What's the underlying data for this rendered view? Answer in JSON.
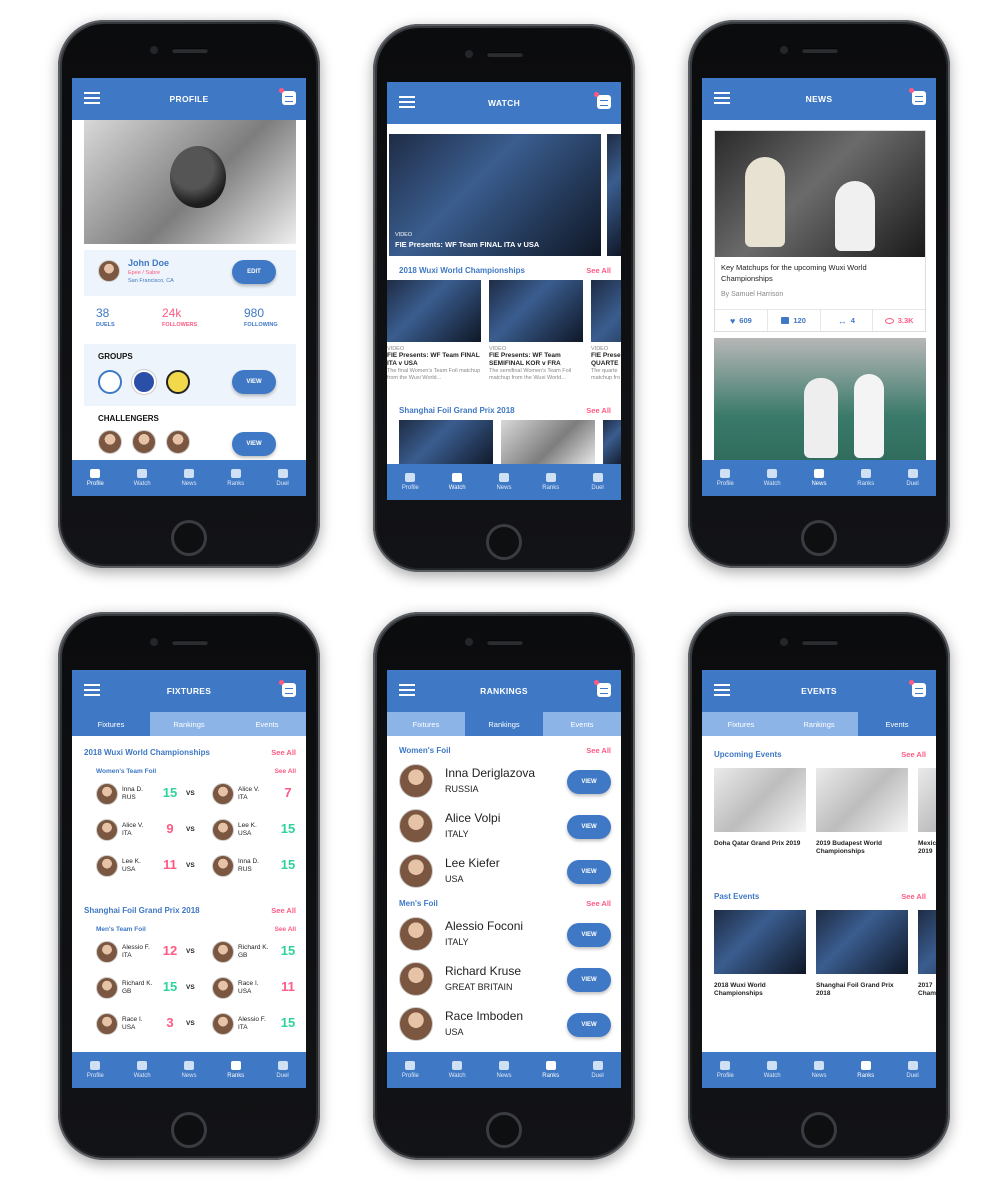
{
  "tabbar": [
    "Profile",
    "Watch",
    "News",
    "Ranks",
    "Duel"
  ],
  "subtabs": [
    "Fixtures",
    "Rankings",
    "Events"
  ],
  "profile": {
    "title": "PROFILE",
    "name": "John Doe",
    "weapons": "Epee / Sabre",
    "location": "San Francisco, CA",
    "edit_label": "EDIT",
    "stats": [
      {
        "value": "38",
        "label": "DUELS",
        "color": "#3f78c4"
      },
      {
        "value": "24k",
        "label": "FOLLOWERS",
        "color": "#ff5a82"
      },
      {
        "value": "980",
        "label": "FOLLOWING",
        "color": "#3f78c4"
      }
    ],
    "groups_label": "GROUPS",
    "challengers_label": "CHALLENGERS",
    "view_label": "VIEW"
  },
  "watch": {
    "title": "WATCH",
    "hero_tag": "VIDEO",
    "hero_title": "FIE Presents: WF Team FINAL ITA v USA",
    "section1": "2018 Wuxi World Championships",
    "section2": "Shanghai Foil Grand Prix 2018",
    "see_all": "See All",
    "videos": [
      {
        "tag": "VIDEO",
        "title": "FIE Presents: WF Team FINAL ITA v USA",
        "desc": "The final Women's Team Foil matchup from the Wuxi World..."
      },
      {
        "tag": "VIDEO",
        "title": "FIE Presents: WF Team SEMIFINAL KOR v FRA",
        "desc": "The semifinal Women's Team Foil matchup from the Wuxi World..."
      },
      {
        "tag": "VIDEO",
        "title": "FIE Prese QUARTE",
        "desc": "The quarte matchup fro"
      }
    ]
  },
  "news": {
    "title": "NEWS",
    "headline": "Key Matchups for the upcoming Wuxi World Championships",
    "byline": "By Samuel Harrison",
    "likes": "609",
    "comments": "120",
    "shares": "4",
    "views": "3.3K",
    "accent": "#ff5a82"
  },
  "fixtures": {
    "title": "FIXTURES",
    "see_all": "See All",
    "groups": [
      {
        "event": "2018 Wuxi World Championships",
        "sub": "Women's Team Foil",
        "matches": [
          {
            "a": "Inna D.",
            "ac": "RUS",
            "as": "15",
            "ascol": "#2fd39a",
            "b": "Alice V.",
            "bc": "ITA",
            "bs": "7",
            "bscol": "#ff5a82"
          },
          {
            "a": "Alice V.",
            "ac": "ITA",
            "as": "9",
            "ascol": "#ff5a82",
            "b": "Lee K.",
            "bc": "USA",
            "bs": "15",
            "bscol": "#2fd39a"
          },
          {
            "a": "Lee K.",
            "ac": "USA",
            "as": "11",
            "ascol": "#ff5a82",
            "b": "Inna D.",
            "bc": "RUS",
            "bs": "15",
            "bscol": "#2fd39a"
          }
        ]
      },
      {
        "event": "Shanghai Foil Grand Prix 2018",
        "sub": "Men's Team Foil",
        "matches": [
          {
            "a": "Alessio F.",
            "ac": "ITA",
            "as": "12",
            "ascol": "#ff5a82",
            "b": "Richard K.",
            "bc": "GB",
            "bs": "15",
            "bscol": "#2fd39a"
          },
          {
            "a": "Richard K.",
            "ac": "GB",
            "as": "15",
            "ascol": "#2fd39a",
            "b": "Race I.",
            "bc": "USA",
            "bs": "11",
            "bscol": "#ff5a82"
          },
          {
            "a": "Race I.",
            "ac": "USA",
            "as": "3",
            "ascol": "#ff5a82",
            "b": "Alessio F.",
            "bc": "ITA",
            "bs": "15",
            "bscol": "#2fd39a"
          }
        ]
      }
    ],
    "vs": "VS"
  },
  "rankings": {
    "title": "RANKINGS",
    "see_all": "See All",
    "view_label": "VIEW",
    "sections": [
      {
        "name": "Women's Foil",
        "people": [
          {
            "name": "Inna Deriglazova",
            "country": "RUSSIA"
          },
          {
            "name": "Alice Volpi",
            "country": "ITALY"
          },
          {
            "name": "Lee Kiefer",
            "country": "USA"
          }
        ]
      },
      {
        "name": "Men's Foil",
        "people": [
          {
            "name": "Alessio Foconi",
            "country": "ITALY"
          },
          {
            "name": "Richard Kruse",
            "country": "GREAT BRITAIN"
          },
          {
            "name": "Race Imboden",
            "country": "USA"
          }
        ]
      }
    ]
  },
  "events": {
    "title": "EVENTS",
    "see_all": "See All",
    "upcoming_label": "Upcoming Events",
    "past_label": "Past Events",
    "upcoming": [
      "Doha Qatar Grand Prix 2019",
      "2019 Budapest World Championships",
      "Mexic 2019"
    ],
    "past": [
      "2018 Wuxi World Championships",
      "Shanghai Foil Grand Prix 2018",
      "2017 Cham"
    ]
  }
}
